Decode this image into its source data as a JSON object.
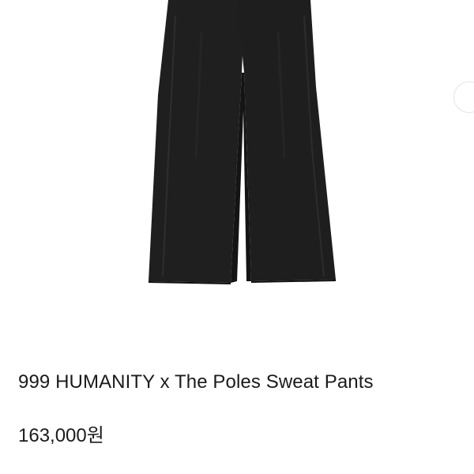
{
  "product": {
    "image_alt": "black wide-leg sweat pants",
    "title": "999 HUMANITY x The Poles Sweat Pants",
    "price": "163,000원"
  },
  "icons": {
    "next_image": "next-image-button-icon"
  },
  "colors": {
    "pants": "#1e1e1e",
    "text": "#1b1b1b",
    "background": "#ffffff"
  }
}
